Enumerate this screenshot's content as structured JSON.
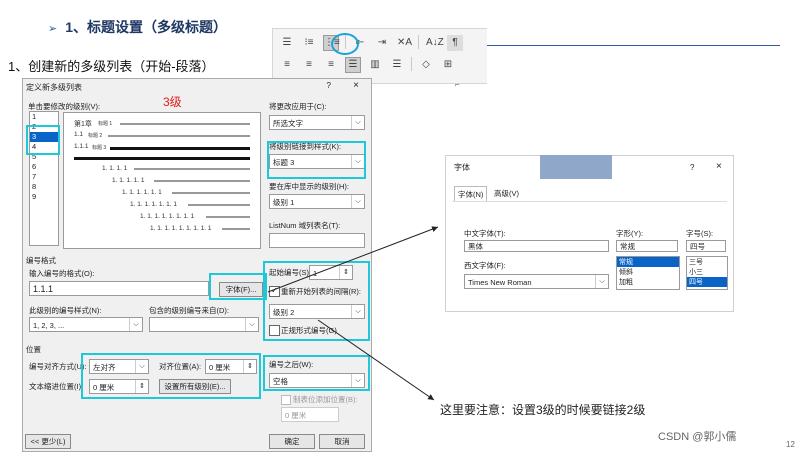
{
  "slide": {
    "title_arrow": "➢",
    "title": "1、标题设置（多级标题）",
    "step": "1、创建新的多级列表（开始-段落）",
    "annotation_red": "3级",
    "note": "这里要注意：设置3级的时候要链接2级",
    "watermark": "CSDN @郭小儒",
    "page_number": "12"
  },
  "ribbon": {
    "row1": [
      "☰",
      "⁝≡",
      "⋮≡",
      "⇤",
      "⇥",
      "✕A",
      "A↓Z",
      "¶"
    ],
    "row2": [
      "≡",
      "≡",
      "≡",
      "☰",
      "▥",
      "☰",
      "◇",
      "⊞"
    ],
    "corner_icon": "⌐"
  },
  "dialog": {
    "title": "定义新多级列表",
    "help": "?",
    "close": "×",
    "click_level_label": "单击要修改的级别(V):",
    "levels": [
      "1",
      "2",
      "3",
      "4",
      "5",
      "6",
      "7",
      "8",
      "9"
    ],
    "selected_level": "3",
    "preview": {
      "line1": "第1章",
      "line1_tag": "标题 1",
      "line2": "1.1",
      "line2_tag": "标题 2",
      "line3": "1.1.1",
      "line3_tag": "标题 3",
      "rows": [
        "1. 1. 1. 1",
        "1. 1. 1. 1. 1",
        "1. 1. 1. 1. 1. 1",
        "1. 1. 1. 1. 1. 1. 1",
        "1. 1. 1. 1. 1. 1. 1. 1",
        "1. 1. 1. 1. 1. 1. 1. 1. 1"
      ]
    },
    "apply_to_label": "将更改应用于(C):",
    "apply_to_value": "所选文字",
    "link_style_label": "将级别链接到样式(K):",
    "link_style_value": "标题 3",
    "gallery_level_label": "要在库中显示的级别(H):",
    "gallery_level_value": "级别 1",
    "listnum_label": "ListNum 域列表名(T):",
    "listnum_value": "",
    "number_format_section": "编号格式",
    "number_format_label": "输入编号的格式(O):",
    "number_format_value": "1.1.1",
    "font_button": "字体(F)...",
    "style_label": "此级别的编号样式(N):",
    "style_value": "1, 2, 3, ...",
    "include_label": "包含的级别编号来自(D):",
    "include_value": "",
    "start_at_label": "起始编号(S):",
    "start_at_value": "1",
    "restart_label": "重新开始列表的间隔(R):",
    "restart_checked": true,
    "restart_value": "级别 2",
    "legal_label": "正规形式编号(G)",
    "legal_checked": false,
    "position_section": "位置",
    "alignment_label": "编号对齐方式(U):",
    "alignment_value": "左对齐",
    "align_at_label": "对齐位置(A):",
    "align_at_value": "0 厘米",
    "indent_label": "文本缩进位置(I):",
    "indent_value": "0 厘米",
    "set_all_button": "设置所有级别(E)...",
    "follow_label": "编号之后(W):",
    "follow_value": "空格",
    "tab_add_label": "制表位添加位置(B):",
    "tab_add_value": "0 厘米",
    "less_button": "<< 更少(L)",
    "ok_button": "确定",
    "cancel_button": "取消"
  },
  "font_dialog": {
    "title": "字体",
    "help": "?",
    "close": "×",
    "tabs": [
      "字体(N)",
      "高级(V)"
    ],
    "cn_font_label": "中文字体(T):",
    "cn_font_value": "黑体",
    "west_font_label": "西文字体(F):",
    "west_font_value": "Times New Roman",
    "style_label": "字形(Y):",
    "style_value": "常规",
    "style_options": [
      "常规",
      "倾斜",
      "加粗"
    ],
    "size_label": "字号(S):",
    "size_value": "四号",
    "size_options": [
      "三号",
      "小三",
      "四号"
    ]
  }
}
